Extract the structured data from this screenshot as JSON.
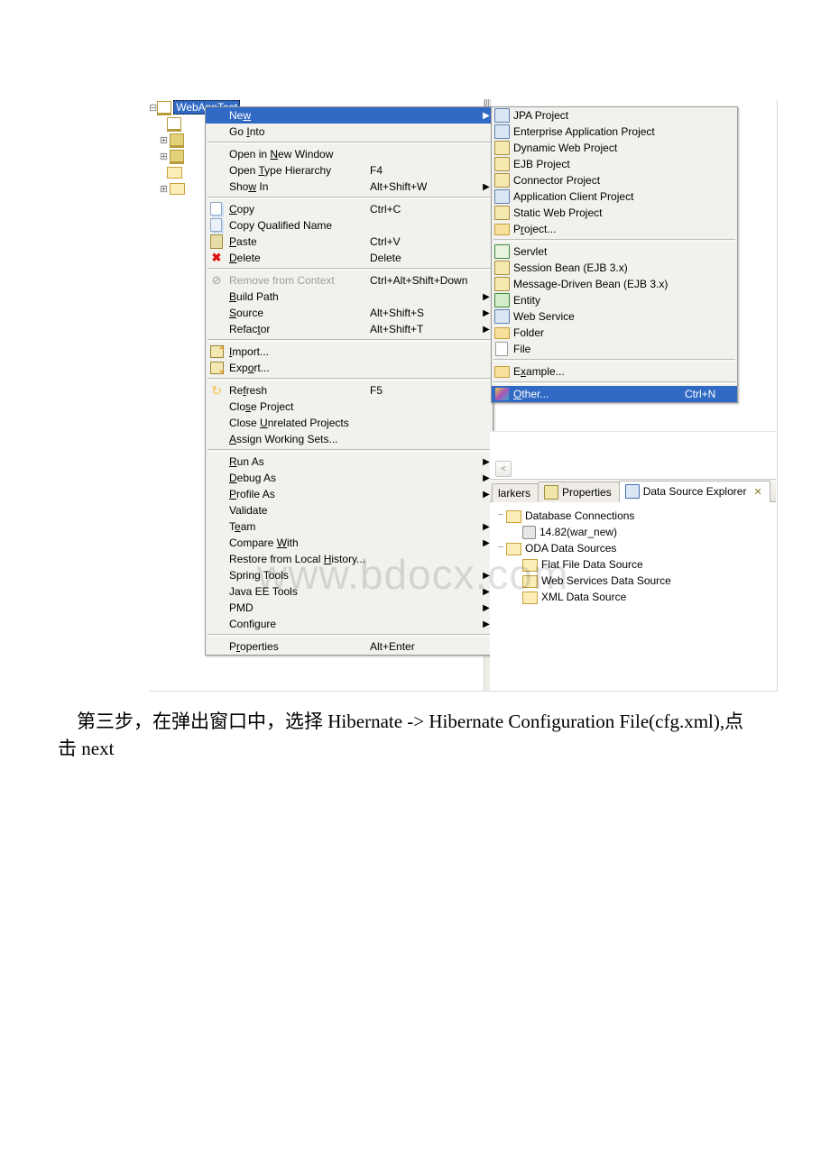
{
  "tree": {
    "root": "WebAppTest"
  },
  "menu": [
    {
      "label": "Ne<u>w</u>",
      "accel": "",
      "arrow": true,
      "sel": true
    },
    {
      "label": "Go <u>I</u>nto",
      "accel": ""
    },
    {
      "sep": true
    },
    {
      "label": "Open in <u>N</u>ew Window",
      "accel": ""
    },
    {
      "label": "Open <u>T</u>ype Hierarchy",
      "accel": "F4"
    },
    {
      "label": "Sho<u>w</u> In",
      "accel": "Alt+Shift+W",
      "arrow": true
    },
    {
      "sep": true
    },
    {
      "label": "<u>C</u>opy",
      "accel": "Ctrl+C",
      "icon": "copy"
    },
    {
      "label": "Copy Qualified Name",
      "icon": "copyq"
    },
    {
      "label": "<u>P</u>aste",
      "accel": "Ctrl+V",
      "icon": "paste"
    },
    {
      "label": "<u>D</u>elete",
      "accel": "Delete",
      "icon": "delete"
    },
    {
      "sep": true
    },
    {
      "label": "Remove from Context",
      "accel": "Ctrl+Alt+Shift+Down",
      "icon": "remove",
      "disabled": true
    },
    {
      "label": "<u>B</u>uild Path",
      "arrow": true
    },
    {
      "label": "<u>S</u>ource",
      "accel": "Alt+Shift+S",
      "arrow": true
    },
    {
      "label": "Refac<u>t</u>or",
      "accel": "Alt+Shift+T",
      "arrow": true
    },
    {
      "sep": true
    },
    {
      "label": "<u>I</u>mport...",
      "icon": "import"
    },
    {
      "label": "Exp<u>o</u>rt...",
      "icon": "export"
    },
    {
      "sep": true
    },
    {
      "label": "Re<u>f</u>resh",
      "accel": "F5",
      "icon": "refresh"
    },
    {
      "label": "Clo<u>s</u>e Project"
    },
    {
      "label": "Close <u>U</u>nrelated Projects"
    },
    {
      "label": "<u>A</u>ssign Working Sets..."
    },
    {
      "sep": true
    },
    {
      "label": "<u>R</u>un As",
      "arrow": true
    },
    {
      "label": "<u>D</u>ebug As",
      "arrow": true
    },
    {
      "label": "<u>P</u>rofile As",
      "arrow": true
    },
    {
      "label": "Validate"
    },
    {
      "label": "T<u>e</u>am",
      "arrow": true
    },
    {
      "label": "Compare <u>W</u>ith",
      "arrow": true
    },
    {
      "label": "Restore from Local <u>H</u>istory..."
    },
    {
      "label": "Spring Tools",
      "arrow": true
    },
    {
      "label": "Java EE Tools",
      "arrow": true
    },
    {
      "label": "PMD",
      "arrow": true
    },
    {
      "label": "Configure",
      "arrow": true
    },
    {
      "sep": true
    },
    {
      "label": "P<u>r</u>operties",
      "accel": "Alt+Enter"
    }
  ],
  "submenu": [
    {
      "label": "JPA Project",
      "ico": "blue"
    },
    {
      "label": "Enterprise Application Project",
      "ico": "blue"
    },
    {
      "label": "Dynamic Web Project",
      "ico": ""
    },
    {
      "label": "EJB Project",
      "ico": ""
    },
    {
      "label": "Connector Project",
      "ico": ""
    },
    {
      "label": "Application Client Project",
      "ico": "blue"
    },
    {
      "label": "Static Web Project",
      "ico": ""
    },
    {
      "label": "P<u>r</u>oject...",
      "ico": "folder"
    },
    {
      "sep": true
    },
    {
      "label": "Servlet",
      "ico": "servlet"
    },
    {
      "label": "Session Bean (EJB 3.x)",
      "ico": ""
    },
    {
      "label": "Message-Driven Bean (EJB 3.x)",
      "ico": ""
    },
    {
      "label": "Entity",
      "ico": "entity"
    },
    {
      "label": "Web Service",
      "ico": "blue"
    },
    {
      "label": "Folder",
      "ico": "folder"
    },
    {
      "label": "File",
      "ico": "file"
    },
    {
      "sep": true
    },
    {
      "label": "E<u>x</u>ample...",
      "ico": "folder"
    },
    {
      "sep": true
    },
    {
      "label": "<u>O</u>ther...",
      "accel": "Ctrl+N",
      "ico": "other",
      "sel": true
    }
  ],
  "tabs": {
    "left": "larkers",
    "mid": "Properties",
    "active": "Data Source Explorer"
  },
  "dstree": [
    {
      "ind": 0,
      "exp": "−",
      "ico": "dfico open",
      "label": "Database Connections"
    },
    {
      "ind": 1,
      "exp": "",
      "ico": "dbico",
      "label": "14.82(war_new)"
    },
    {
      "ind": 0,
      "exp": "−",
      "ico": "dfico open",
      "label": "ODA Data Sources"
    },
    {
      "ind": 1,
      "exp": "",
      "ico": "dfico open",
      "label": "Flat File Data Source"
    },
    {
      "ind": 1,
      "exp": "",
      "ico": "dfico open",
      "label": "Web Services Data Source"
    },
    {
      "ind": 1,
      "exp": "",
      "ico": "dfico open",
      "label": "XML Data Source"
    }
  ],
  "watermark": "www.bdocx.com",
  "instruction": "第三步，在弹出窗口中，选择 Hibernate -> Hibernate Configuration File(cfg.xml),点击 next"
}
